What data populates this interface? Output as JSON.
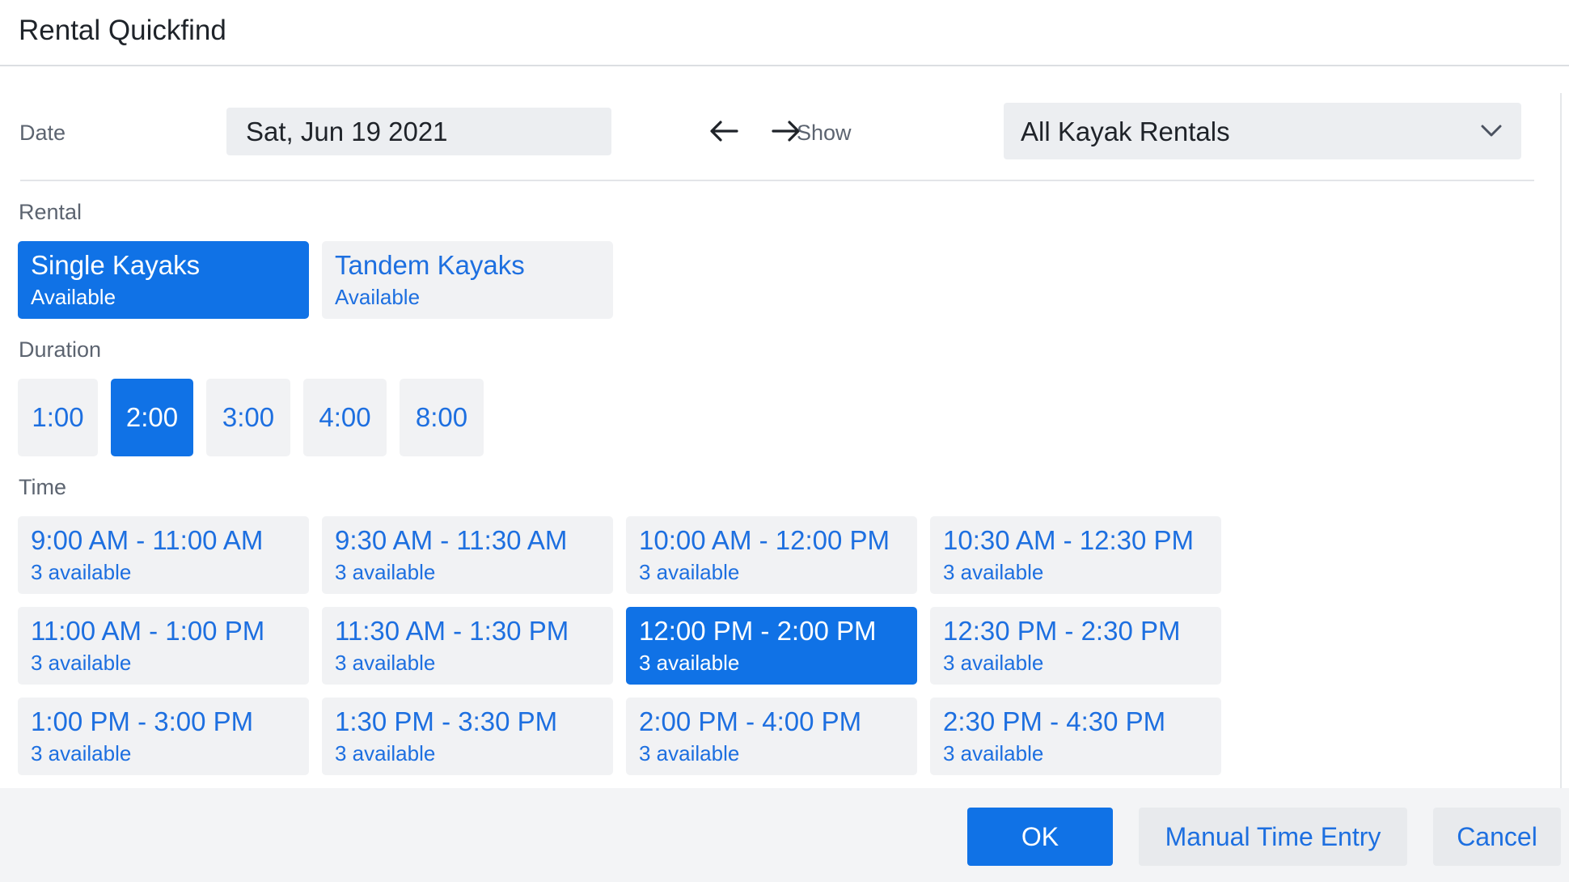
{
  "window": {
    "title": "Rental Quickfind"
  },
  "date": {
    "label": "Date",
    "value": "Sat, Jun 19 2021",
    "prev_icon": "arrow-left-icon",
    "next_icon": "arrow-right-icon"
  },
  "show": {
    "label": "Show",
    "value": "All Kayak Rentals",
    "icon": "chevron-down-icon"
  },
  "rental": {
    "label": "Rental",
    "items": [
      {
        "name": "Single Kayaks",
        "status": "Available",
        "selected": true
      },
      {
        "name": "Tandem Kayaks",
        "status": "Available",
        "selected": false
      }
    ]
  },
  "duration": {
    "label": "Duration",
    "items": [
      {
        "label": "1:00",
        "selected": false
      },
      {
        "label": "2:00",
        "selected": true
      },
      {
        "label": "3:00",
        "selected": false
      },
      {
        "label": "4:00",
        "selected": false
      },
      {
        "label": "8:00",
        "selected": false
      }
    ]
  },
  "time": {
    "label": "Time",
    "slots": [
      {
        "range": "9:00 AM - 11:00 AM",
        "availability": "3 available",
        "selected": false
      },
      {
        "range": "9:30 AM - 11:30 AM",
        "availability": "3 available",
        "selected": false
      },
      {
        "range": "10:00 AM - 12:00 PM",
        "availability": "3 available",
        "selected": false
      },
      {
        "range": "10:30 AM - 12:30 PM",
        "availability": "3 available",
        "selected": false
      },
      {
        "range": "11:00 AM - 1:00 PM",
        "availability": "3 available",
        "selected": false
      },
      {
        "range": "11:30 AM - 1:30 PM",
        "availability": "3 available",
        "selected": false
      },
      {
        "range": "12:00 PM - 2:00 PM",
        "availability": "3 available",
        "selected": true
      },
      {
        "range": "12:30 PM - 2:30 PM",
        "availability": "3 available",
        "selected": false
      },
      {
        "range": "1:00 PM - 3:00 PM",
        "availability": "3 available",
        "selected": false
      },
      {
        "range": "1:30 PM - 3:30 PM",
        "availability": "3 available",
        "selected": false
      },
      {
        "range": "2:00 PM - 4:00 PM",
        "availability": "3 available",
        "selected": false
      },
      {
        "range": "2:30 PM - 4:30 PM",
        "availability": "3 available",
        "selected": false
      }
    ]
  },
  "footer": {
    "ok_label": "OK",
    "manual_label": "Manual Time Entry",
    "cancel_label": "Cancel"
  },
  "colors": {
    "accent": "#1072e6",
    "accent_text": "#1d6fe0",
    "tile_bg": "#f1f2f4"
  }
}
